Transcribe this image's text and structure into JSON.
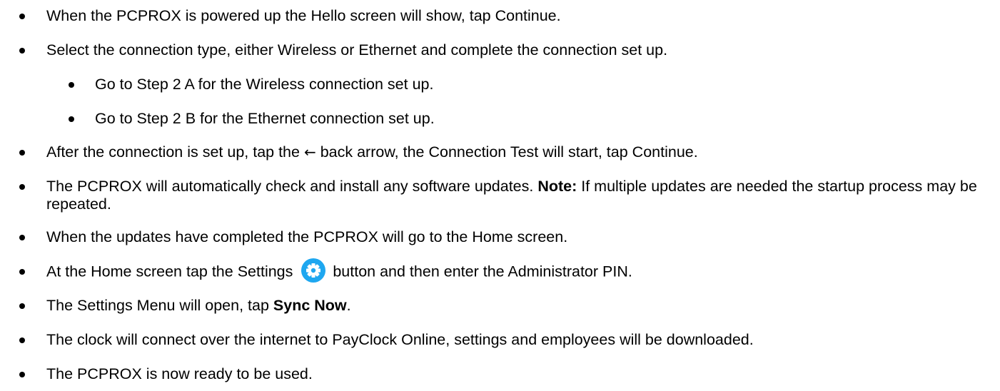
{
  "items": [
    {
      "text": "When the PCPROX is powered up the Hello screen will show, tap Continue."
    },
    {
      "text": "Select the connection type, either Wireless or Ethernet and complete the connection set up."
    },
    {
      "text": "Go to Step 2 A for the Wireless connection set up."
    },
    {
      "text": "Go to Step 2 B for the Ethernet connection set up."
    },
    {
      "before": "After the connection is set up, tap the ",
      "arrow": "←",
      "after": " back arrow, the Connection Test will start, tap Continue."
    },
    {
      "before": "The PCPROX will automatically check and install any software updates. ",
      "bold": "Note:",
      "after": " If multiple updates are needed the startup process may be repeated."
    },
    {
      "text": "When the updates have completed the PCPROX will go to the Home screen."
    },
    {
      "before": " At the Home screen tap the Settings ",
      "icon": "gear-icon",
      "after": " button and then enter the Administrator PIN."
    },
    {
      "before": "The Settings Menu will open, tap ",
      "bold": "Sync Now",
      "after": "."
    },
    {
      "text": "The clock will connect over the internet to PayClock Online, settings and employees will be downloaded."
    },
    {
      "text": "The PCPROX is now ready to be used."
    }
  ],
  "colors": {
    "gear_button": "#1ea7f0",
    "text": "#000000"
  }
}
